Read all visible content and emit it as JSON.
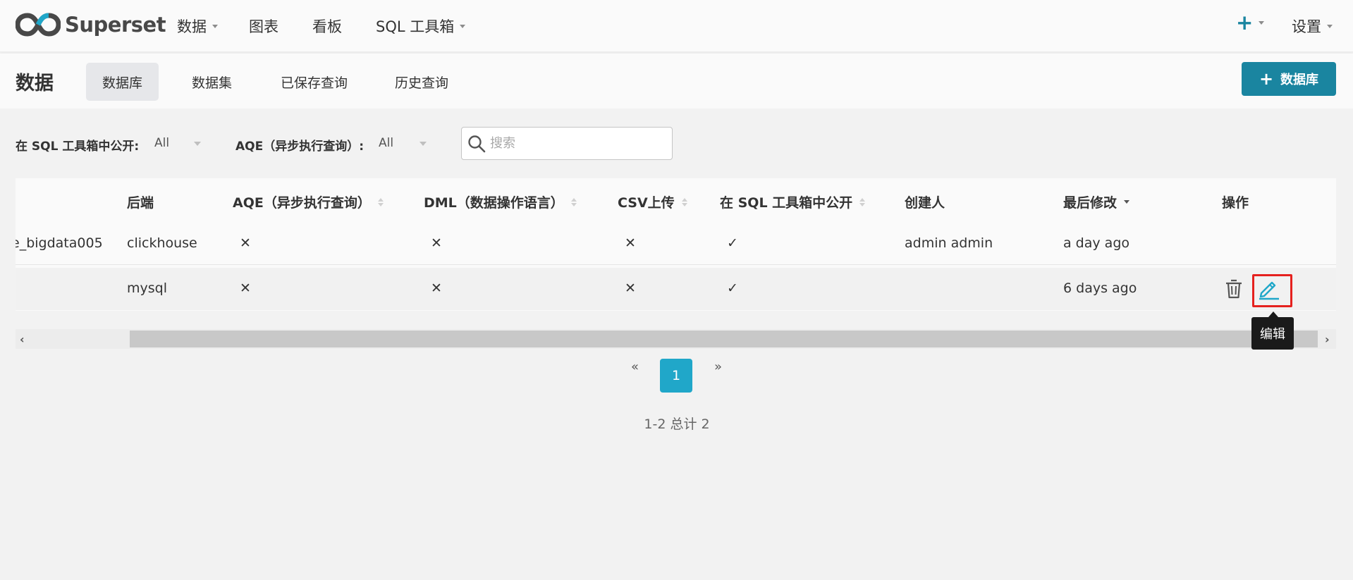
{
  "topnav": {
    "brand": "Superset",
    "items": [
      {
        "label": "数据",
        "dropdown": true
      },
      {
        "label": "图表",
        "dropdown": false
      },
      {
        "label": "看板",
        "dropdown": false
      },
      {
        "label": "SQL 工具箱",
        "dropdown": true
      }
    ],
    "plus_label": "+",
    "settings_label": "设置"
  },
  "subheader": {
    "title": "数据",
    "tabs": [
      {
        "label": "数据库",
        "active": true
      },
      {
        "label": "数据集",
        "active": false
      },
      {
        "label": "已保存查询",
        "active": false
      },
      {
        "label": "历史查询",
        "active": false
      }
    ],
    "add_button_label": "数据库"
  },
  "filters": {
    "sql_lab_label": "在 SQL 工具箱中公开:",
    "sql_lab_value": "All",
    "aqe_label": "AQE（异步执行查询）:",
    "aqe_value": "All",
    "search_placeholder": "搜索"
  },
  "table": {
    "columns": [
      "后端",
      "AQE（异步执行查询）",
      "DML（数据操作语言）",
      "CSV上传",
      "在 SQL 工具箱中公开",
      "创建人",
      "最后修改",
      "操作"
    ],
    "rows": [
      {
        "name": "e_bigdata005",
        "backend": "clickhouse",
        "aqe": "✕",
        "dml": "✕",
        "csv": "✕",
        "sql_lab": "✓",
        "created_by": "admin admin",
        "modified": "a day ago"
      },
      {
        "name": "",
        "backend": "mysql",
        "aqe": "✕",
        "dml": "✕",
        "csv": "✕",
        "sql_lab": "✓",
        "created_by": "",
        "modified": "6 days ago"
      }
    ]
  },
  "tooltip": "编辑",
  "scroll": {
    "left_arrow": "‹",
    "right_arrow": "›"
  },
  "pagination": {
    "prev": "«",
    "current": "1",
    "next": "»",
    "total": "1-2 总计 2"
  },
  "colors": {
    "primary": "#1a85a0",
    "page_active": "#20a7c9",
    "highlight": "#e5211e",
    "logo_blue": "#20a7c9",
    "logo_dark": "#484848"
  }
}
